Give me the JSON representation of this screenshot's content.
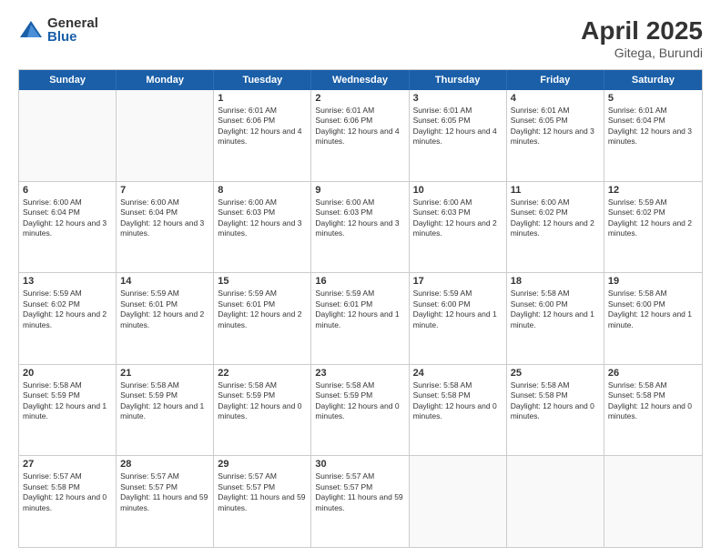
{
  "logo": {
    "general": "General",
    "blue": "Blue"
  },
  "title": "April 2025",
  "subtitle": "Gitega, Burundi",
  "days": [
    "Sunday",
    "Monday",
    "Tuesday",
    "Wednesday",
    "Thursday",
    "Friday",
    "Saturday"
  ],
  "weeks": [
    [
      {
        "day": "",
        "text": ""
      },
      {
        "day": "",
        "text": ""
      },
      {
        "day": "1",
        "text": "Sunrise: 6:01 AM\nSunset: 6:06 PM\nDaylight: 12 hours and 4 minutes."
      },
      {
        "day": "2",
        "text": "Sunrise: 6:01 AM\nSunset: 6:06 PM\nDaylight: 12 hours and 4 minutes."
      },
      {
        "day": "3",
        "text": "Sunrise: 6:01 AM\nSunset: 6:05 PM\nDaylight: 12 hours and 4 minutes."
      },
      {
        "day": "4",
        "text": "Sunrise: 6:01 AM\nSunset: 6:05 PM\nDaylight: 12 hours and 3 minutes."
      },
      {
        "day": "5",
        "text": "Sunrise: 6:01 AM\nSunset: 6:04 PM\nDaylight: 12 hours and 3 minutes."
      }
    ],
    [
      {
        "day": "6",
        "text": "Sunrise: 6:00 AM\nSunset: 6:04 PM\nDaylight: 12 hours and 3 minutes."
      },
      {
        "day": "7",
        "text": "Sunrise: 6:00 AM\nSunset: 6:04 PM\nDaylight: 12 hours and 3 minutes."
      },
      {
        "day": "8",
        "text": "Sunrise: 6:00 AM\nSunset: 6:03 PM\nDaylight: 12 hours and 3 minutes."
      },
      {
        "day": "9",
        "text": "Sunrise: 6:00 AM\nSunset: 6:03 PM\nDaylight: 12 hours and 3 minutes."
      },
      {
        "day": "10",
        "text": "Sunrise: 6:00 AM\nSunset: 6:03 PM\nDaylight: 12 hours and 2 minutes."
      },
      {
        "day": "11",
        "text": "Sunrise: 6:00 AM\nSunset: 6:02 PM\nDaylight: 12 hours and 2 minutes."
      },
      {
        "day": "12",
        "text": "Sunrise: 5:59 AM\nSunset: 6:02 PM\nDaylight: 12 hours and 2 minutes."
      }
    ],
    [
      {
        "day": "13",
        "text": "Sunrise: 5:59 AM\nSunset: 6:02 PM\nDaylight: 12 hours and 2 minutes."
      },
      {
        "day": "14",
        "text": "Sunrise: 5:59 AM\nSunset: 6:01 PM\nDaylight: 12 hours and 2 minutes."
      },
      {
        "day": "15",
        "text": "Sunrise: 5:59 AM\nSunset: 6:01 PM\nDaylight: 12 hours and 2 minutes."
      },
      {
        "day": "16",
        "text": "Sunrise: 5:59 AM\nSunset: 6:01 PM\nDaylight: 12 hours and 1 minute."
      },
      {
        "day": "17",
        "text": "Sunrise: 5:59 AM\nSunset: 6:00 PM\nDaylight: 12 hours and 1 minute."
      },
      {
        "day": "18",
        "text": "Sunrise: 5:58 AM\nSunset: 6:00 PM\nDaylight: 12 hours and 1 minute."
      },
      {
        "day": "19",
        "text": "Sunrise: 5:58 AM\nSunset: 6:00 PM\nDaylight: 12 hours and 1 minute."
      }
    ],
    [
      {
        "day": "20",
        "text": "Sunrise: 5:58 AM\nSunset: 5:59 PM\nDaylight: 12 hours and 1 minute."
      },
      {
        "day": "21",
        "text": "Sunrise: 5:58 AM\nSunset: 5:59 PM\nDaylight: 12 hours and 1 minute."
      },
      {
        "day": "22",
        "text": "Sunrise: 5:58 AM\nSunset: 5:59 PM\nDaylight: 12 hours and 0 minutes."
      },
      {
        "day": "23",
        "text": "Sunrise: 5:58 AM\nSunset: 5:59 PM\nDaylight: 12 hours and 0 minutes."
      },
      {
        "day": "24",
        "text": "Sunrise: 5:58 AM\nSunset: 5:58 PM\nDaylight: 12 hours and 0 minutes."
      },
      {
        "day": "25",
        "text": "Sunrise: 5:58 AM\nSunset: 5:58 PM\nDaylight: 12 hours and 0 minutes."
      },
      {
        "day": "26",
        "text": "Sunrise: 5:58 AM\nSunset: 5:58 PM\nDaylight: 12 hours and 0 minutes."
      }
    ],
    [
      {
        "day": "27",
        "text": "Sunrise: 5:57 AM\nSunset: 5:58 PM\nDaylight: 12 hours and 0 minutes."
      },
      {
        "day": "28",
        "text": "Sunrise: 5:57 AM\nSunset: 5:57 PM\nDaylight: 11 hours and 59 minutes."
      },
      {
        "day": "29",
        "text": "Sunrise: 5:57 AM\nSunset: 5:57 PM\nDaylight: 11 hours and 59 minutes."
      },
      {
        "day": "30",
        "text": "Sunrise: 5:57 AM\nSunset: 5:57 PM\nDaylight: 11 hours and 59 minutes."
      },
      {
        "day": "",
        "text": ""
      },
      {
        "day": "",
        "text": ""
      },
      {
        "day": "",
        "text": ""
      }
    ]
  ]
}
